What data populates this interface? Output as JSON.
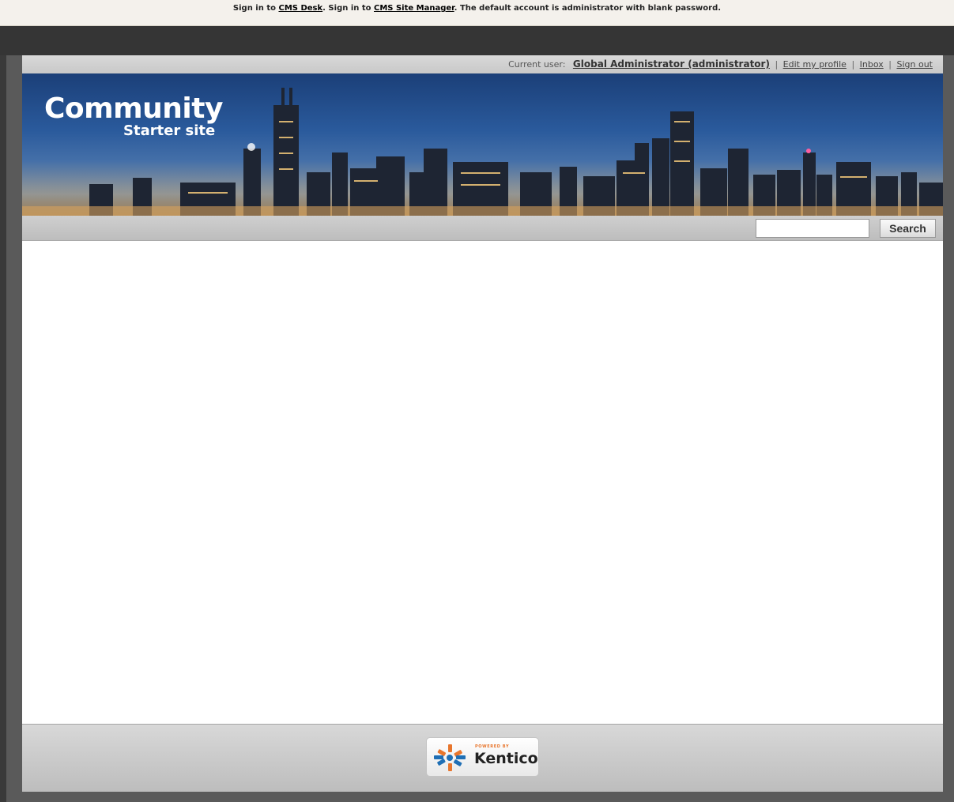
{
  "top_bar": {
    "prefix1": "Sign in to ",
    "cms_desk_link": "CMS Desk",
    "mid": ". Sign in to ",
    "site_manager_link": "CMS Site Manager",
    "suffix": ". The default account is administrator with blank password."
  },
  "user_bar": {
    "label": "Current user:",
    "user_name": "Global Administrator (administrator)",
    "separator": "|",
    "links": [
      "Edit my profile",
      "Inbox",
      "Sign out"
    ]
  },
  "banner": {
    "title": "Community",
    "subtitle": "Starter site"
  },
  "search": {
    "input_value": "",
    "button_label": "Search"
  },
  "footer": {
    "powered_by": "POWERED BY",
    "brand": "Kentico"
  },
  "colors": {
    "banner_sky": "#2a5a9c",
    "accent_orange": "#e8762d",
    "kentico_blue": "#1f6fb5"
  }
}
